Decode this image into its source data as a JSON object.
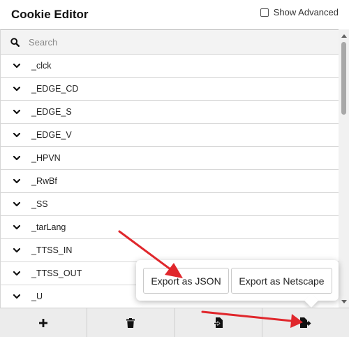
{
  "header": {
    "title": "Cookie Editor",
    "show_advanced_label": "Show Advanced",
    "show_advanced_checked": false
  },
  "search": {
    "placeholder": "Search",
    "value": ""
  },
  "cookies": [
    {
      "name": "_clck"
    },
    {
      "name": "_EDGE_CD"
    },
    {
      "name": "_EDGE_S"
    },
    {
      "name": "_EDGE_V"
    },
    {
      "name": "_HPVN"
    },
    {
      "name": "_RwBf"
    },
    {
      "name": "_SS"
    },
    {
      "name": "_tarLang"
    },
    {
      "name": "_TTSS_IN"
    },
    {
      "name": "_TTSS_OUT"
    },
    {
      "name": "_U"
    }
  ],
  "export_popup": {
    "json_label": "Export as JSON",
    "netscape_label": "Export as Netscape"
  },
  "footer": {
    "buttons": [
      {
        "icon": "plus-icon"
      },
      {
        "icon": "trash-icon"
      },
      {
        "icon": "import-icon"
      },
      {
        "icon": "export-icon"
      }
    ]
  },
  "colors": {
    "annotation_arrow": "#e0272c",
    "footer_bg": "#ececec",
    "search_bg": "#f3f3f3"
  }
}
